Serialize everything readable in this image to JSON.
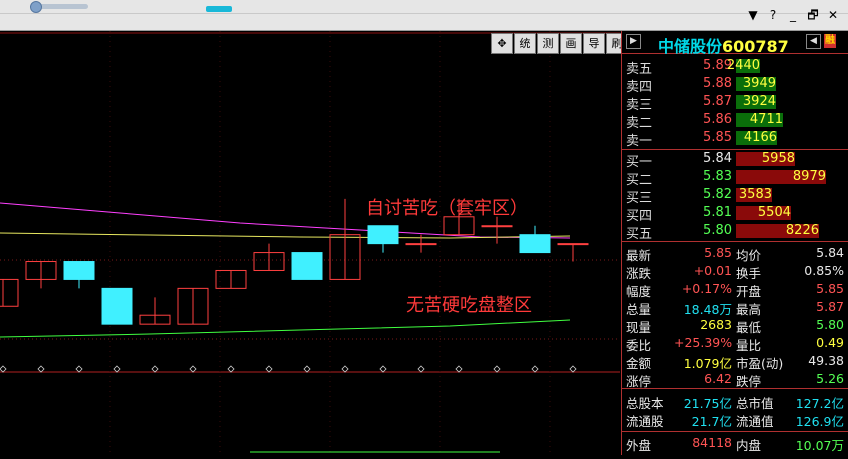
{
  "window": {
    "buttons": [
      {
        "name": "dropdown-arrow-icon",
        "glyph": "▼"
      },
      {
        "name": "help-icon",
        "glyph": "?"
      },
      {
        "name": "minimize-icon",
        "glyph": "_"
      },
      {
        "name": "restore-icon",
        "glyph": "🗗"
      },
      {
        "name": "close-icon",
        "glyph": "✕"
      }
    ]
  },
  "toolbar": {
    "items": [
      {
        "name": "crosshair-tool",
        "label": "✥"
      },
      {
        "name": "tool-tong",
        "label": "统"
      },
      {
        "name": "tool-ce",
        "label": "测"
      },
      {
        "name": "tool-hua",
        "label": "画"
      },
      {
        "name": "tool-dao",
        "label": "导"
      },
      {
        "name": "tool-shua",
        "label": "刷"
      }
    ]
  },
  "stock": {
    "name": "中储股份",
    "code": "600787",
    "tag": "融",
    "nav_left": "▶",
    "nav_right": "◀"
  },
  "annotations": {
    "upper": "自讨苦吃（套牢区）",
    "lower": "无苦硬吃盘整区"
  },
  "asks": [
    {
      "label": "卖五",
      "price": "5.89",
      "volume": "2440",
      "fill": 0.27
    },
    {
      "label": "卖四",
      "price": "5.88",
      "volume": "3949",
      "fill": 0.44
    },
    {
      "label": "卖三",
      "price": "5.87",
      "volume": "3924",
      "fill": 0.44
    },
    {
      "label": "卖二",
      "price": "5.86",
      "volume": "4711",
      "fill": 0.52
    },
    {
      "label": "卖一",
      "price": "5.85",
      "volume": "4166",
      "fill": 0.46
    }
  ],
  "bids": [
    {
      "label": "买一",
      "price": "5.84",
      "volume": "5958",
      "fill": 0.66
    },
    {
      "label": "买二",
      "price": "5.83",
      "volume": "8979",
      "fill": 1.0
    },
    {
      "label": "买三",
      "price": "5.82",
      "volume": "3583",
      "fill": 0.4
    },
    {
      "label": "买四",
      "price": "5.81",
      "volume": "5504",
      "fill": 0.61
    },
    {
      "label": "买五",
      "price": "5.80",
      "volume": "8226",
      "fill": 0.92
    }
  ],
  "quote": [
    {
      "l1": "最新",
      "v1": "5.85",
      "c1": "red",
      "l2": "均价",
      "v2": "5.84",
      "c2": "white"
    },
    {
      "l1": "涨跌",
      "v1": "+0.01",
      "c1": "red",
      "l2": "换手",
      "v2": "0.85%",
      "c2": "white"
    },
    {
      "l1": "幅度",
      "v1": "+0.17%",
      "c1": "red",
      "l2": "开盘",
      "v2": "5.85",
      "c2": "red"
    },
    {
      "l1": "总量",
      "v1": "18.48万",
      "c1": "cyan",
      "l2": "最高",
      "v2": "5.87",
      "c2": "red"
    },
    {
      "l1": "现量",
      "v1": "2683",
      "c1": "yellow",
      "l2": "最低",
      "v2": "5.80",
      "c2": "green"
    },
    {
      "l1": "委比",
      "v1": "+25.39%",
      "c1": "red",
      "l2": "量比",
      "v2": "0.49",
      "c2": "yellow"
    },
    {
      "l1": "金额",
      "v1": "1.079亿",
      "c1": "yellow",
      "l2": "市盈(动)",
      "v2": "49.38",
      "c2": "white"
    },
    {
      "l1": "涨停",
      "v1": "6.42",
      "c1": "red",
      "l2": "跌停",
      "v2": "5.26",
      "c2": "green"
    }
  ],
  "capital": [
    {
      "l1": "总股本",
      "v1": "21.75亿",
      "l2": "总市值",
      "v2": "127.2亿"
    },
    {
      "l1": "流通股",
      "v1": "21.7亿",
      "l2": "流通值",
      "v2": "126.9亿"
    }
  ],
  "outer": {
    "l1": "外盘",
    "v1": "84118",
    "l2": "内盘",
    "v2": "10.07万"
  },
  "colors": {
    "up": "#ff4040",
    "down": "#40f0ff",
    "ma1": "#ff40ff",
    "ma2": "#e8e860",
    "ma3": "#40ff40"
  },
  "candles": [
    {
      "o": 5.77,
      "c": 5.8,
      "h": 5.8,
      "l": 5.77
    },
    {
      "o": 5.8,
      "c": 5.82,
      "h": 5.82,
      "l": 5.79
    },
    {
      "o": 5.82,
      "c": 5.8,
      "h": 5.82,
      "l": 5.79
    },
    {
      "o": 5.79,
      "c": 5.75,
      "h": 5.79,
      "l": 5.75
    },
    {
      "o": 5.75,
      "c": 5.76,
      "h": 5.78,
      "l": 5.75
    },
    {
      "o": 5.75,
      "c": 5.79,
      "h": 5.79,
      "l": 5.75
    },
    {
      "o": 5.79,
      "c": 5.81,
      "h": 5.81,
      "l": 5.79
    },
    {
      "o": 5.81,
      "c": 5.83,
      "h": 5.84,
      "l": 5.81
    },
    {
      "o": 5.83,
      "c": 5.8,
      "h": 5.83,
      "l": 5.8
    },
    {
      "o": 5.8,
      "c": 5.85,
      "h": 5.89,
      "l": 5.8
    },
    {
      "o": 5.86,
      "c": 5.84,
      "h": 5.86,
      "l": 5.83
    },
    {
      "o": 5.84,
      "c": 5.84,
      "h": 5.85,
      "l": 5.83
    },
    {
      "o": 5.85,
      "c": 5.87,
      "h": 5.89,
      "l": 5.85
    },
    {
      "o": 5.86,
      "c": 5.86,
      "h": 5.87,
      "l": 5.84
    },
    {
      "o": 5.85,
      "c": 5.83,
      "h": 5.86,
      "l": 5.83
    },
    {
      "o": 5.84,
      "c": 5.84,
      "h": 5.84,
      "l": 5.82
    }
  ]
}
